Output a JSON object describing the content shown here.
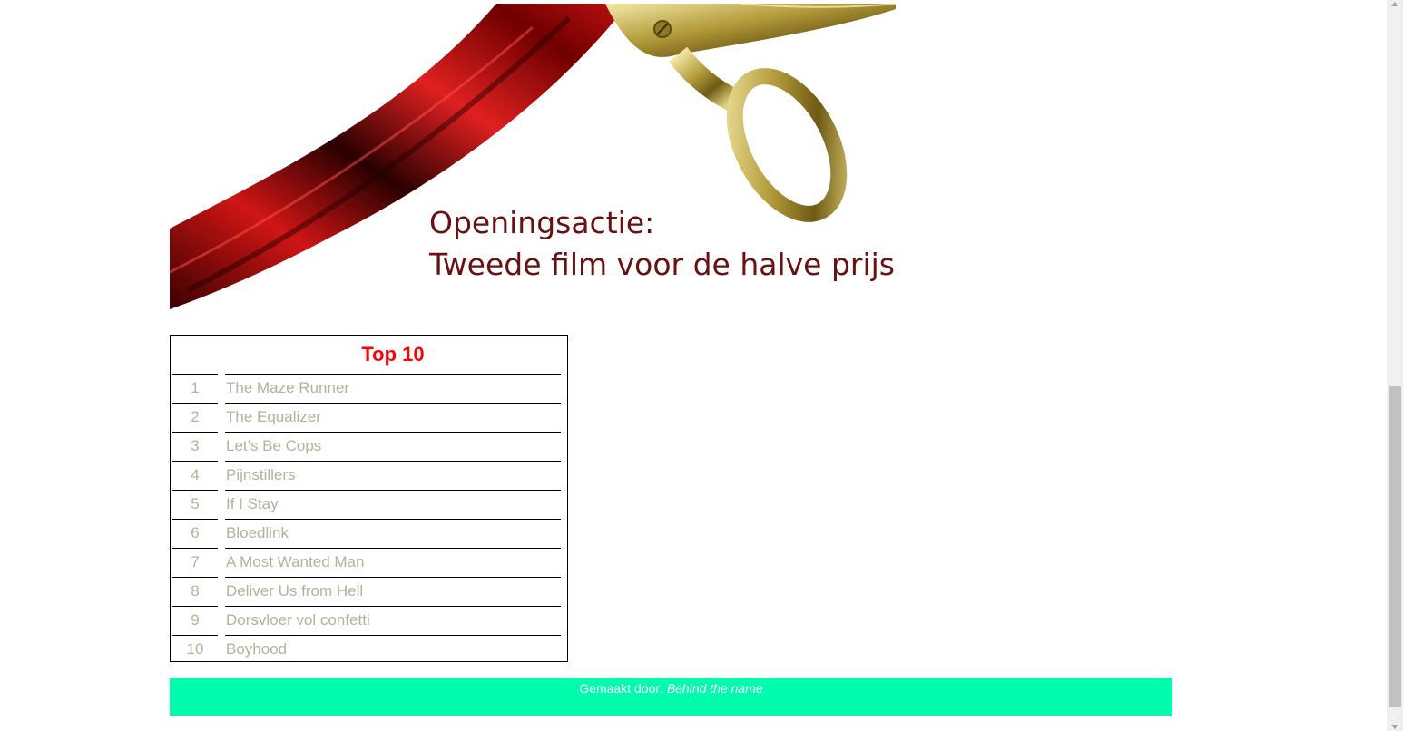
{
  "promo": {
    "line1": "Openingsactie:",
    "line2": "Tweede film voor de halve prijs!"
  },
  "top10": {
    "title": "Top 10",
    "items": [
      {
        "rank": "1",
        "title": "The Maze Runner"
      },
      {
        "rank": "2",
        "title": "The Equalizer"
      },
      {
        "rank": "3",
        "title": "Let's Be Cops"
      },
      {
        "rank": "4",
        "title": "Pijnstillers"
      },
      {
        "rank": "5",
        "title": "If I Stay"
      },
      {
        "rank": "6",
        "title": "Bloedlink"
      },
      {
        "rank": "7",
        "title": "A Most Wanted Man"
      },
      {
        "rank": "8",
        "title": "Deliver Us from Hell"
      },
      {
        "rank": "9",
        "title": "Dorsvloer vol confetti"
      },
      {
        "rank": "10",
        "title": "Boyhood"
      }
    ]
  },
  "footer": {
    "prefix": "Gemaakt door:",
    "credit": "Behind the name"
  },
  "colors": {
    "footer_bg": "#00fdae",
    "top10_title": "#ff0000",
    "list_text": "#b5b29a",
    "promo_text": "#6b1010"
  }
}
